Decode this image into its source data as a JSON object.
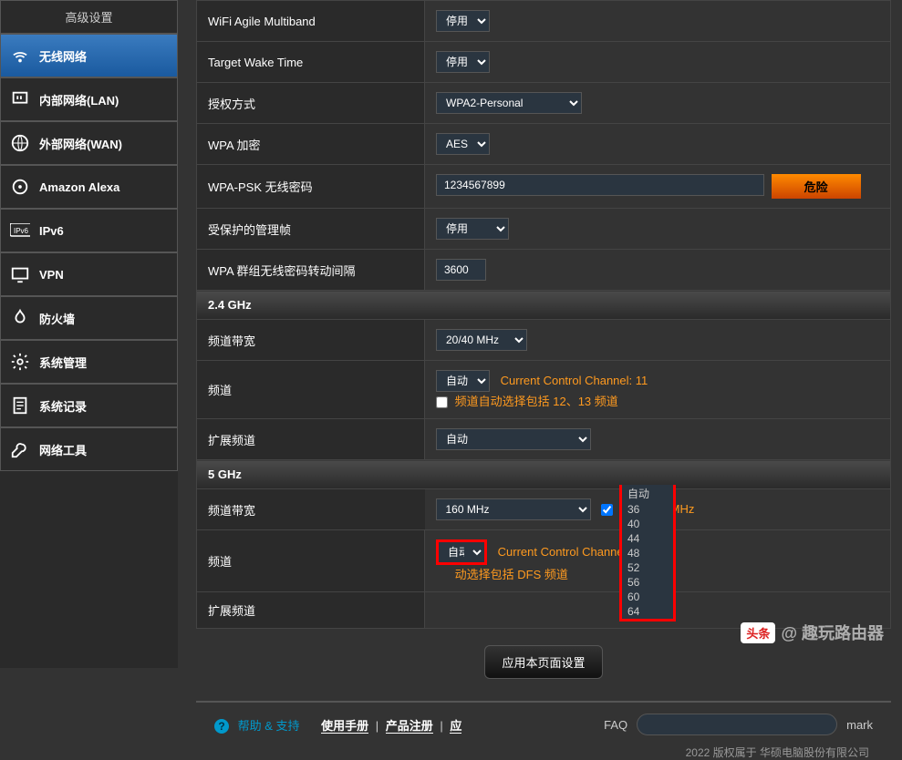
{
  "sidebar": {
    "title": "高级设置",
    "items": [
      {
        "label": "无线网络",
        "icon": "wifi-icon"
      },
      {
        "label": "内部网络(LAN)",
        "icon": "lan-icon"
      },
      {
        "label": "外部网络(WAN)",
        "icon": "globe-icon"
      },
      {
        "label": "Amazon Alexa",
        "icon": "alexa-icon"
      },
      {
        "label": "IPv6",
        "icon": "ipv6-icon"
      },
      {
        "label": "VPN",
        "icon": "vpn-icon"
      },
      {
        "label": "防火墙",
        "icon": "firewall-icon"
      },
      {
        "label": "系统管理",
        "icon": "admin-icon"
      },
      {
        "label": "系统记录",
        "icon": "log-icon"
      },
      {
        "label": "网络工具",
        "icon": "tools-icon"
      }
    ]
  },
  "settings": {
    "wifi_agile_multiband": {
      "label": "WiFi Agile Multiband",
      "value": "停用"
    },
    "target_wake_time": {
      "label": "Target Wake Time",
      "value": "停用"
    },
    "auth_method": {
      "label": "授权方式",
      "value": "WPA2-Personal"
    },
    "wpa_encryption": {
      "label": "WPA 加密",
      "value": "AES"
    },
    "wpa_psk": {
      "label": "WPA-PSK 无线密码",
      "value": "1234567899",
      "danger": "危险"
    },
    "protected_mgmt": {
      "label": "受保护的管理帧",
      "value": "停用"
    },
    "wpa_group_rekey": {
      "label": "WPA 群组无线密码转动间隔",
      "value": "3600"
    },
    "section_24": "2.4 GHz",
    "bandwidth_24": {
      "label": "频道带宽",
      "value": "20/40 MHz"
    },
    "channel_24": {
      "label": "频道",
      "value": "自动",
      "hint": "Current Control Channel: 11",
      "checkbox_label": "频道自动选择包括 12、13 频道"
    },
    "ext_channel_24": {
      "label": "扩展频道",
      "value": "自动"
    },
    "section_5": "5 GHz",
    "bandwidth_5": {
      "label": "频道带宽",
      "value": "160 MHz",
      "checkbox_label": "启用 160 MHz"
    },
    "channel_5": {
      "label": "频道",
      "value": "自动",
      "hint": "Current Control Channel: 44",
      "checkbox_label": "动选择包括 DFS 频道",
      "options": [
        "自动",
        "36",
        "40",
        "44",
        "48",
        "52",
        "56",
        "60",
        "64"
      ]
    },
    "ext_channel_5": {
      "label": "扩展频道"
    }
  },
  "apply_button": "应用本页面设置",
  "footer": {
    "help": "帮助 & 支持",
    "manual": "使用手册",
    "register": "产品注册",
    "app": "应",
    "faq": "FAQ"
  },
  "copyright": "2022 版权属于 华硕电脑股份有限公司",
  "watermark": {
    "badge": "头条",
    "text": "@ 趣玩路由器"
  }
}
